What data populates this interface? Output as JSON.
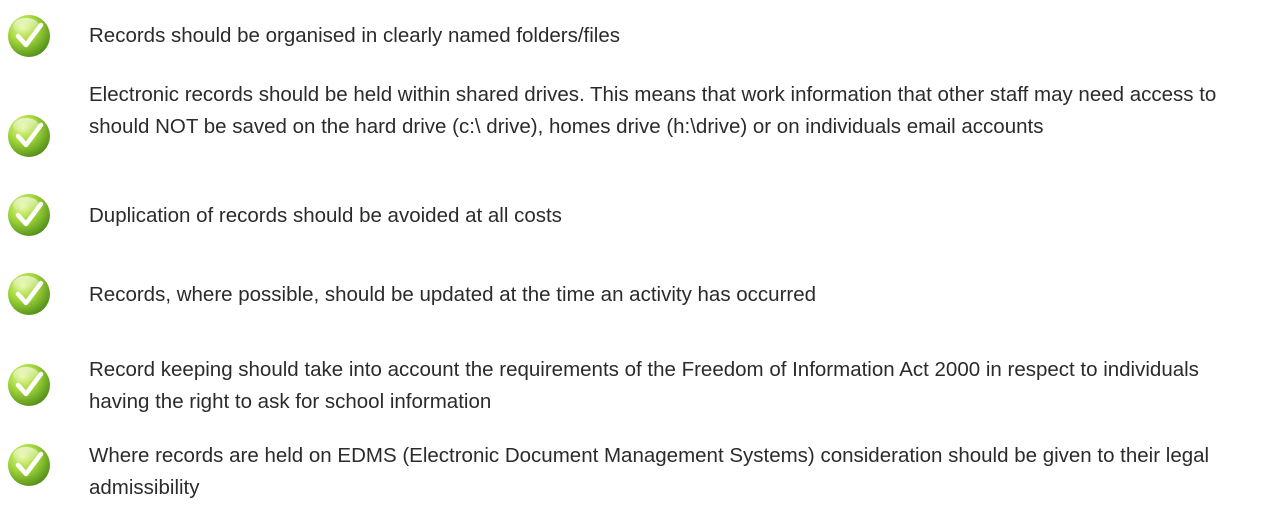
{
  "checklist": {
    "items": [
      {
        "icon": "check-icon",
        "text": "Records should be organised in clearly named folders/files"
      },
      {
        "icon": "check-icon",
        "text": "Electronic records should be held within shared drives. This means that work information that other staff may need access to should NOT be saved on the hard drive (c:\\ drive), homes drive (h:\\drive) or on individuals email accounts"
      },
      {
        "icon": "check-icon",
        "text": "Duplication of records should be avoided at all costs"
      },
      {
        "icon": "check-icon",
        "text": "Records, where possible, should be updated at the time an activity has occurred"
      },
      {
        "icon": "check-icon",
        "text": "Record keeping should take into account the requirements of the Freedom of Information Act 2000 in respect to individuals having the right to ask for school information"
      },
      {
        "icon": "check-icon",
        "text": "Where records are held on EDMS (Electronic Document Management Systems) consideration should be given to their legal admissibility"
      }
    ],
    "colors": {
      "check_light": "#c4ec5a",
      "check_dark": "#5a9a1e",
      "check_mark": "#ffffff",
      "text": "#2b2b2b"
    }
  }
}
